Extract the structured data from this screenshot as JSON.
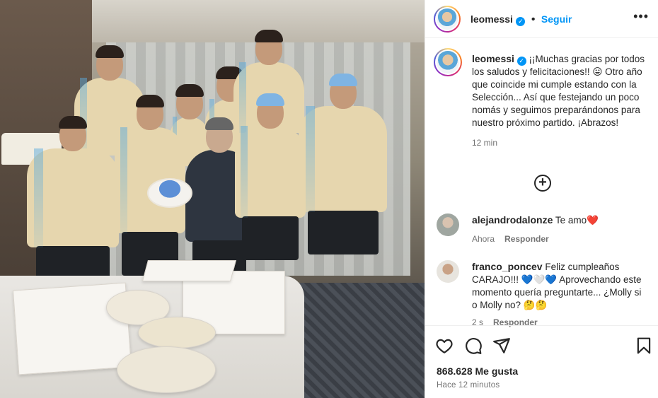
{
  "post": {
    "username": "leomessi",
    "follow_label": "Seguir",
    "more_options_icon": "more-dots-icon",
    "caption": "¡¡Muchas gracias por todos los saludos y felicitaciones!! 😛 Otro año que coincide mi cumple estando con la Selección... Así que festejando un poco nomás y seguimos preparándonos para nuestro próximo partido. ¡Abrazos!",
    "caption_time": "12 min",
    "load_more_icon": "plus-circle-icon"
  },
  "comments": [
    {
      "username": "alejandrodalonze",
      "text": "Te amo❤️",
      "time": "Ahora",
      "reply_label": "Responder"
    },
    {
      "username": "franco_poncev",
      "text": "Feliz cumpleaños CARAJO!!! 💙🤍💙 Aprovechando este momento quería preguntarte... ¿Molly si o Molly no? 🤔🤔",
      "time": "2 s",
      "reply_label": "Responder"
    }
  ],
  "actions": {
    "like_icon": "heart-icon",
    "comment_icon": "comment-icon",
    "share_icon": "share-icon",
    "save_icon": "bookmark-icon",
    "likes_label": "868.628 Me gusta",
    "posted_ago": "Hace 12 minutos"
  },
  "colors": {
    "accent": "#0095f6",
    "text": "#262626",
    "secondary": "#737373",
    "divider": "#efefef"
  }
}
